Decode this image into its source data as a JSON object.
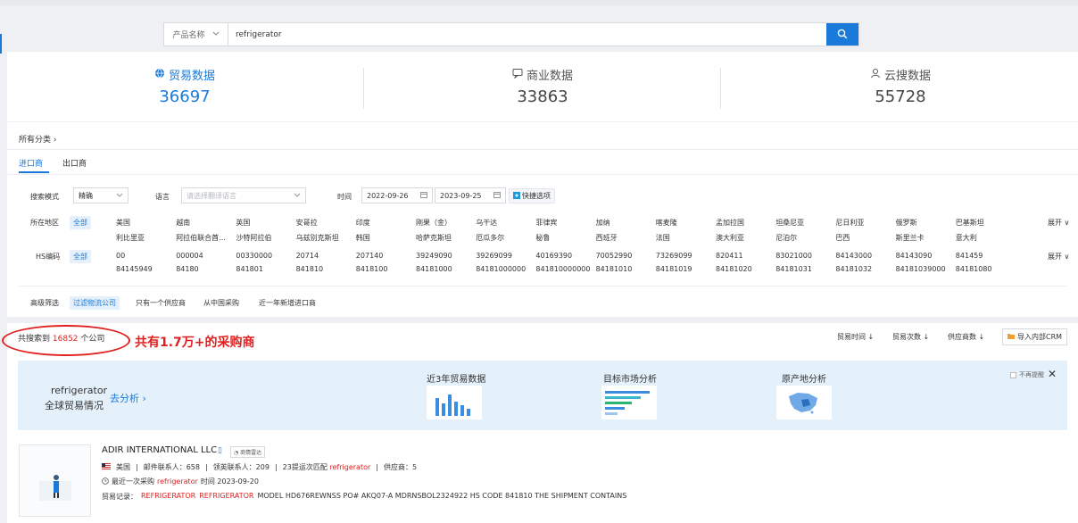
{
  "search": {
    "category": "产品名称",
    "query": "refrigerator"
  },
  "stats": [
    {
      "label": "贸易数据",
      "value": "36697"
    },
    {
      "label": "商业数据",
      "value": "33863"
    },
    {
      "label": "云搜数据",
      "value": "55728"
    }
  ],
  "breadcrumb": "所有分类",
  "tabs": [
    "进口商",
    "出口商"
  ],
  "filters": {
    "mode_label": "搜索模式",
    "mode_value": "精确",
    "lang_label": "语言",
    "lang_placeholder": "请选择翻译语言",
    "time_label": "时间",
    "date_start": "2022-09-26",
    "date_end": "2023-09-25",
    "quick_label": "快捷选项"
  },
  "region": {
    "label": "所在地区",
    "all": "全部",
    "expand": "展开",
    "row1": [
      "美国",
      "越南",
      "英国",
      "安哥拉",
      "印度",
      "刚果（金）",
      "乌干达",
      "菲律宾",
      "加纳",
      "喀麦隆",
      "孟加拉国",
      "坦桑尼亚",
      "尼日利亚",
      "俄罗斯",
      "巴基斯坦"
    ],
    "row2": [
      "利比里亚",
      "阿拉伯联合酋...",
      "沙特阿拉伯",
      "乌兹别克斯坦",
      "韩国",
      "哈萨克斯坦",
      "厄瓜多尔",
      "秘鲁",
      "西班牙",
      "法国",
      "澳大利亚",
      "尼泊尔",
      "巴西",
      "斯里兰卡",
      "意大利"
    ]
  },
  "hs": {
    "label": "HS编码",
    "all": "全部",
    "expand": "展开",
    "row1": [
      "00",
      "000004",
      "00330000",
      "20714",
      "207140",
      "39249090",
      "39269099",
      "40169390",
      "70052990",
      "73269099",
      "820411",
      "83021000",
      "84143000",
      "84143090",
      "841459"
    ],
    "row2": [
      "84145949",
      "84180",
      "841801",
      "841810",
      "8418100",
      "84181000",
      "84181000000",
      "841810000000",
      "84181010",
      "84181019",
      "84181020",
      "84181031",
      "84181032",
      "84181039000",
      "84181080"
    ]
  },
  "advanced": {
    "label": "高级筛选",
    "options": [
      "过滤物流公司",
      "只有一个供应商",
      "从中国采购",
      "近一年新增进口商"
    ]
  },
  "results": {
    "prefix": "共搜索到",
    "count": "16852",
    "suffix": "个公司",
    "annotation": "共有1.7万+的采购商",
    "sort": [
      "贸易时间",
      "贸易次数",
      "供应商数"
    ],
    "crm": "导入内部CRM"
  },
  "banner": {
    "product": "refrigerator",
    "subtitle": "全球贸易情况",
    "analyze": "去分析 ›",
    "panels": [
      "近3年贸易数据",
      "目标市场分析",
      "原产地分析"
    ],
    "dismiss": "不再提醒"
  },
  "company": {
    "name": "ADIR INTERNATIONAL LLC",
    "badge": "商情雷达",
    "country": "美国",
    "email_contacts": "邮件联系人：658",
    "linkedin_contacts": "领英联系人：209",
    "match_prefix": "23提运次匹配",
    "match_kw": "refrigerator",
    "suppliers": "供应商：5",
    "recent_prefix": "最近一次采购",
    "recent_kw": "refrigerator",
    "recent_suffix": "时间 2023-09-20",
    "record_label": "贸易记录：",
    "record_kw1": "REFRIGERATOR",
    "record_kw2": "REFRIGERATOR",
    "record_rest": "MODEL HD676REWNSS PO# AKQ07-A MDRNSBOL2324922 HS CODE 841810 THE SHIPMENT CONTAINS"
  },
  "colors": {
    "accent": "#1a7ad9",
    "highlight": "#e02020",
    "banner": "#e4f0fa"
  }
}
